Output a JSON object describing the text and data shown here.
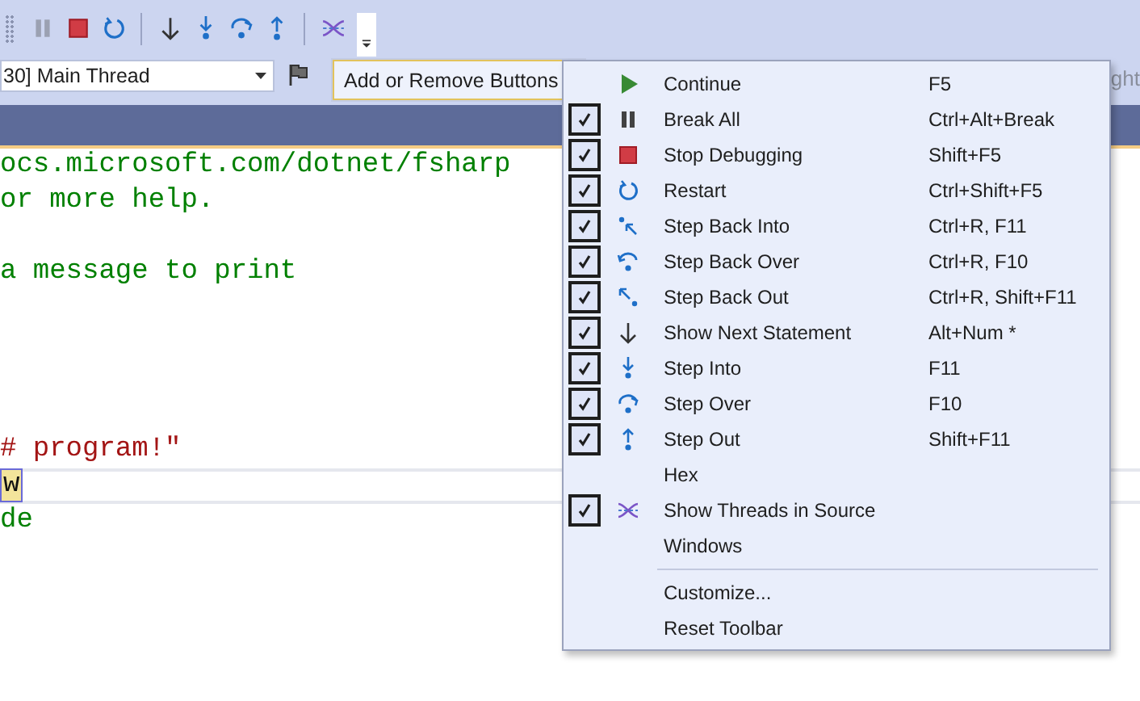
{
  "toolbar": [
    {
      "kind": "pause",
      "disabled": true
    },
    {
      "kind": "stop",
      "disabled": false
    },
    {
      "kind": "restart",
      "disabled": false
    },
    {
      "kind": "separator"
    },
    {
      "kind": "show-next",
      "disabled": false
    },
    {
      "kind": "step-into",
      "disabled": false
    },
    {
      "kind": "step-over",
      "disabled": false
    },
    {
      "kind": "step-out",
      "disabled": false
    },
    {
      "kind": "separator"
    },
    {
      "kind": "threads",
      "disabled": false
    },
    {
      "kind": "overflow",
      "disabled": false
    }
  ],
  "thread_dropdown": {
    "value": "30] Main Thread"
  },
  "add_remove_button": {
    "label": "Add or Remove Buttons",
    "expanded": true
  },
  "partly_hidden_text": "ght",
  "code_lines": [
    {
      "kind": "comment",
      "text": "ocs.microsoft.com/dotnet/fsharp"
    },
    {
      "kind": "comment",
      "text": "or more help."
    },
    {
      "kind": "blank"
    },
    {
      "kind": "comment",
      "text": "a message to print"
    },
    {
      "kind": "blank"
    },
    {
      "kind": "blank"
    },
    {
      "kind": "blank"
    },
    {
      "kind": "blank"
    },
    {
      "kind": "string",
      "text": "# program!\""
    },
    {
      "kind": "current",
      "text": "w"
    },
    {
      "kind": "comment",
      "text": "de"
    }
  ],
  "menu": {
    "items": [
      {
        "label": "Continue",
        "shortcut": "F5",
        "checked": false,
        "kind": "continue"
      },
      {
        "label": "Break All",
        "shortcut": "Ctrl+Alt+Break",
        "checked": true,
        "kind": "pause"
      },
      {
        "label": "Stop Debugging",
        "shortcut": "Shift+F5",
        "checked": true,
        "kind": "stop"
      },
      {
        "label": "Restart",
        "shortcut": "Ctrl+Shift+F5",
        "checked": true,
        "kind": "restart"
      },
      {
        "label": "Step Back Into",
        "shortcut": "Ctrl+R, F11",
        "checked": true,
        "kind": "step-back-into"
      },
      {
        "label": "Step Back Over",
        "shortcut": "Ctrl+R, F10",
        "checked": true,
        "kind": "step-back-over"
      },
      {
        "label": "Step Back Out",
        "shortcut": "Ctrl+R, Shift+F11",
        "checked": true,
        "kind": "step-back-out"
      },
      {
        "label": "Show Next Statement",
        "shortcut": "Alt+Num *",
        "checked": true,
        "kind": "show-next"
      },
      {
        "label": "Step Into",
        "shortcut": "F11",
        "checked": true,
        "kind": "step-into"
      },
      {
        "label": "Step Over",
        "shortcut": "F10",
        "checked": true,
        "kind": "step-over"
      },
      {
        "label": "Step Out",
        "shortcut": "Shift+F11",
        "checked": true,
        "kind": "step-out"
      },
      {
        "label": "Hex",
        "checked": false,
        "kind": "plain"
      },
      {
        "label": "Show Threads in Source",
        "checked": true,
        "kind": "threads"
      },
      {
        "label": "Windows",
        "checked": false,
        "kind": "plain"
      }
    ],
    "footer": [
      "Customize...",
      "Reset Toolbar"
    ]
  }
}
